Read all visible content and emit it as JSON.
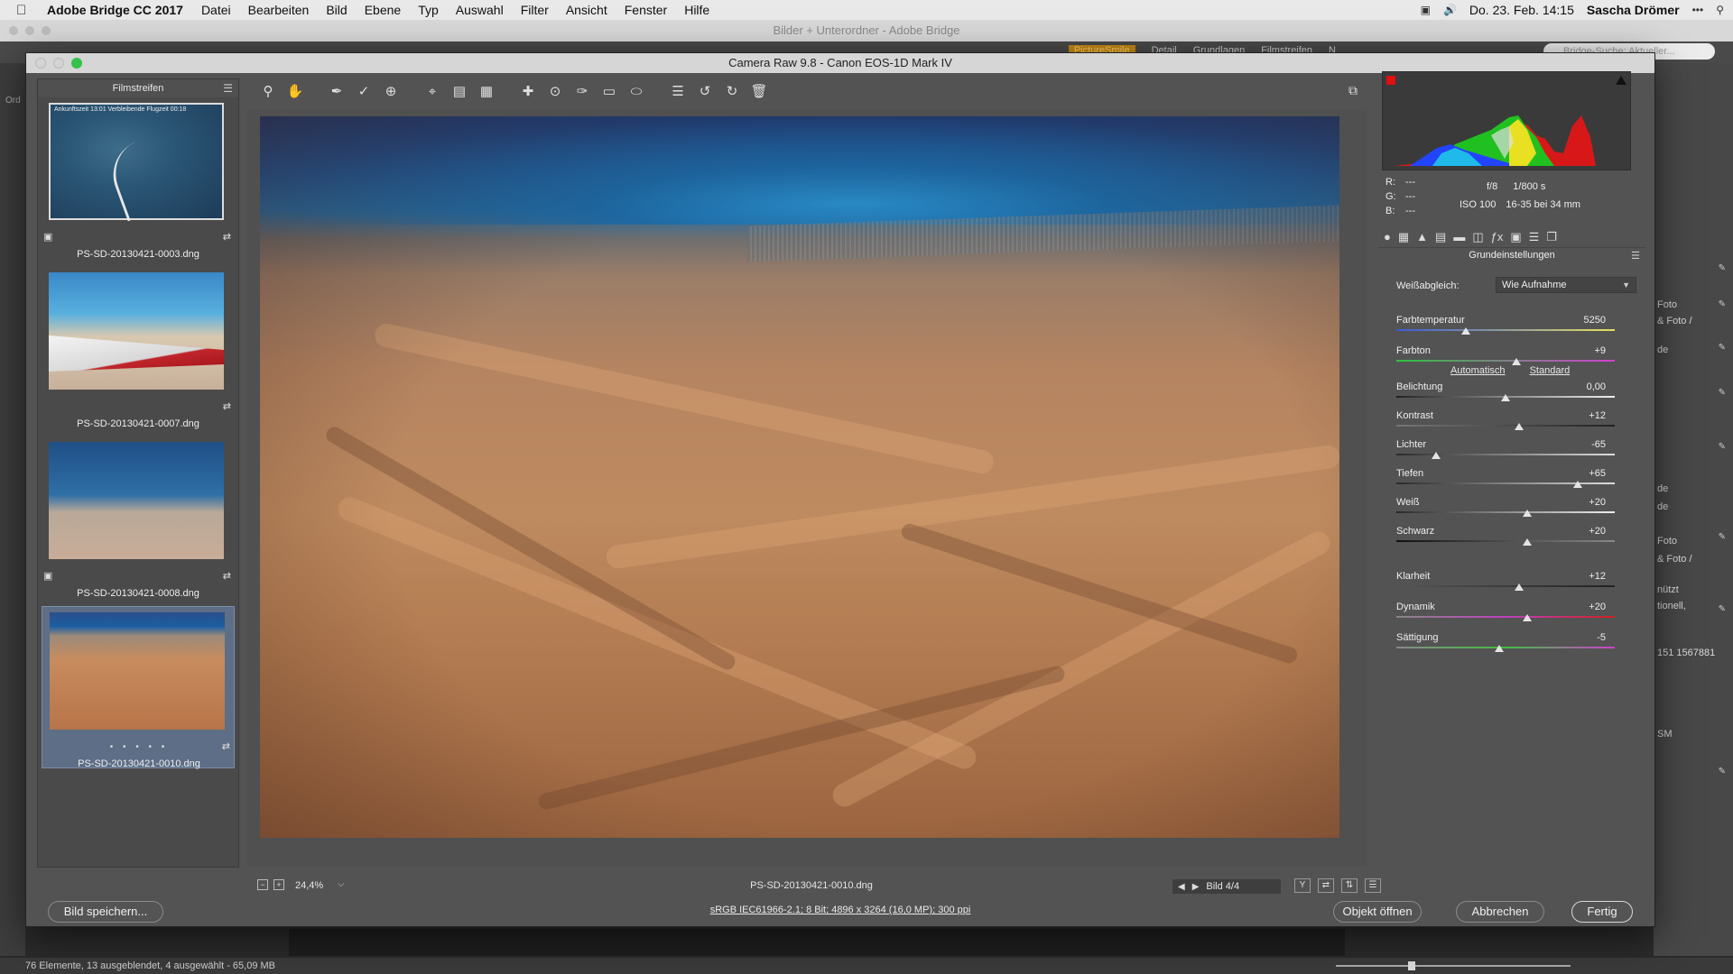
{
  "menubar": {
    "app_name": "Adobe Bridge CC 2017",
    "items": [
      "Datei",
      "Bearbeiten",
      "Bild",
      "Ebene",
      "Typ",
      "Auswahl",
      "Filter",
      "Ansicht",
      "Fenster",
      "Hilfe"
    ],
    "datetime": "Do. 23. Feb.  14:15",
    "user": "Sascha Drömer"
  },
  "bridge": {
    "window_title": "Bilder + Unterordner - Adobe Bridge",
    "workspaces": [
      "PictureSmile",
      "Detail",
      "Grundlagen",
      "Filmstreifen",
      "N"
    ],
    "search_placeholder": "Bridge-Suche: Aktueller...",
    "left_label": "Ord",
    "right_fragments": [
      "Foto",
      "& Foto /",
      "de",
      "de",
      "de",
      "Foto",
      "& Foto /",
      "nützt",
      "tionell,",
      "151 1567881",
      "SM"
    ],
    "status": "76 Elemente, 13 ausgeblendet, 4 ausgewählt - 65,09 MB"
  },
  "dialog": {
    "title": "Camera Raw 9.8  -  Canon EOS-1D Mark IV",
    "filmstrip": {
      "header": "Filmstreifen",
      "items": [
        {
          "name": "PS-SD-20130421-0003.dng",
          "map_text": "Ankunftszeit 13:01   Verbleibende Flugzeit 00:18"
        },
        {
          "name": "PS-SD-20130421-0007.dng"
        },
        {
          "name": "PS-SD-20130421-0008.dng"
        },
        {
          "name": "PS-SD-20130421-0010.dng",
          "rating": "• • • • •"
        }
      ]
    },
    "preview": {
      "zoom": "24,4%",
      "filename": "PS-SD-20130421-0010.dng",
      "nav": "Bild 4/4"
    },
    "histogram": {
      "r": "---",
      "g": "---",
      "b": "---",
      "aperture": "f/8",
      "shutter": "1/800 s",
      "iso": "ISO 100",
      "lens": "16-35 bei 34 mm"
    },
    "panel": {
      "title": "Grundeinstellungen",
      "wb_label": "Weißabgleich:",
      "wb_value": "Wie Aufnahme",
      "auto_label": "Automatisch",
      "default_label": "Standard",
      "sliders": [
        {
          "label": "Farbtemperatur",
          "value": "5250",
          "pos": 0.32
        },
        {
          "label": "Farbton",
          "value": "+9",
          "pos": 0.55
        },
        {
          "label": "Belichtung",
          "value": "0,00",
          "pos": 0.5
        },
        {
          "label": "Kontrast",
          "value": "+12",
          "pos": 0.56
        },
        {
          "label": "Lichter",
          "value": "-65",
          "pos": 0.18
        },
        {
          "label": "Tiefen",
          "value": "+65",
          "pos": 0.83
        },
        {
          "label": "Weiß",
          "value": "+20",
          "pos": 0.6
        },
        {
          "label": "Schwarz",
          "value": "+20",
          "pos": 0.6
        },
        {
          "label": "Klarheit",
          "value": "+12",
          "pos": 0.56
        },
        {
          "label": "Dynamik",
          "value": "+20",
          "pos": 0.6
        },
        {
          "label": "Sättigung",
          "value": "-5",
          "pos": 0.47
        }
      ]
    },
    "workflow_link": "sRGB IEC61966-2.1; 8 Bit; 4896 x 3264 (16,0 MP); 300 ppi",
    "buttons": {
      "save": "Bild speichern...",
      "open": "Objekt öffnen",
      "cancel": "Abbrechen",
      "done": "Fertig"
    }
  },
  "colors": {
    "accent_workspace": "#c78a14",
    "selected_thumb": "#5d6e86"
  }
}
